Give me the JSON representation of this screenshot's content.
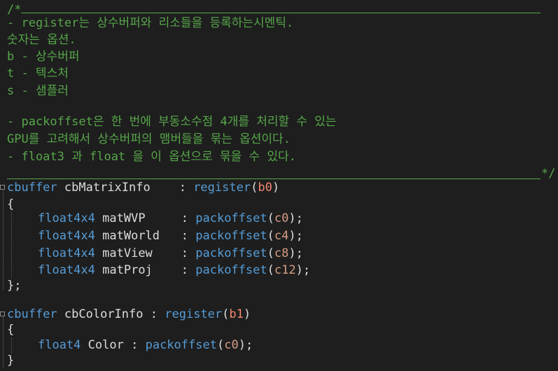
{
  "comment": {
    "open": "/*",
    "close": "*/",
    "lines": [
      "- register는 상수버퍼와 리소들을 등록하는시멘틱.",
      "숫자는 옵션.",
      "b - 상수버퍼",
      "t - 텍스처",
      "s - 샘플러",
      "",
      "- packoffset은 한 번에 부동소수점 4개를 처리할 수 있는",
      "GPU를 고려해서 상수버퍼의 맴버들을 묶는 옵션이다.",
      "- float3 과 float 을 이 옵션으로 묶을 수 있다."
    ]
  },
  "cbuffer1": {
    "keyword": "cbuffer",
    "name": "cbMatrixInfo",
    "colon": ":",
    "semantic": "register",
    "reg": "b0",
    "open_brace": "{",
    "close_brace": "};",
    "members": [
      {
        "type": "float4x4",
        "name": "matWVP  ",
        "fn": "packoffset",
        "arg": "c0"
      },
      {
        "type": "float4x4",
        "name": "matWorld",
        "fn": "packoffset",
        "arg": "c4"
      },
      {
        "type": "float4x4",
        "name": "matView ",
        "fn": "packoffset",
        "arg": "c8"
      },
      {
        "type": "float4x4",
        "name": "matProj ",
        "fn": "packoffset",
        "arg": "c12"
      }
    ]
  },
  "cbuffer2": {
    "keyword": "cbuffer",
    "name": "cbColorInfo",
    "colon": ":",
    "semantic": "register",
    "reg": "b1",
    "open_brace": "{",
    "close_brace": "}",
    "members": [
      {
        "type": "float4",
        "name": "Color",
        "fn": "packoffset",
        "arg": "c0"
      }
    ]
  },
  "colors": {
    "background": "#1e1e1e",
    "comment": "#57a64a",
    "keyword": "#569cd6",
    "identifier": "#dcdcdc",
    "register_arg": "#f48771",
    "offset_arg": "#d69d85"
  }
}
